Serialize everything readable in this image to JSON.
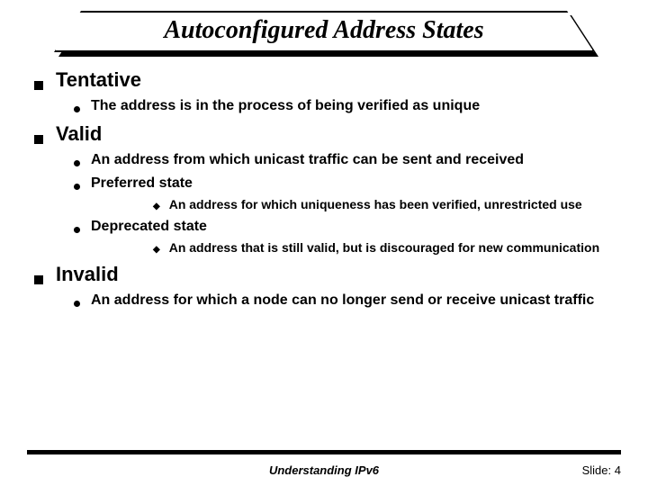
{
  "title": "Autoconfigured Address States",
  "sections": [
    {
      "heading": "Tentative",
      "items": [
        {
          "text": "The address is in the process of being verified as unique"
        }
      ]
    },
    {
      "heading": "Valid",
      "items": [
        {
          "text": "An address from which unicast traffic can be sent and received"
        },
        {
          "text": "Preferred state",
          "subitems": [
            "An address for which uniqueness has been verified, unrestricted use"
          ]
        },
        {
          "text": "Deprecated state",
          "subitems": [
            "An address that is still valid, but is discouraged for new communication"
          ]
        }
      ]
    },
    {
      "heading": "Invalid",
      "items": [
        {
          "text": "An address for which a node can no longer send or receive unicast traffic"
        }
      ]
    }
  ],
  "footer": {
    "center": "Understanding IPv6",
    "slide_label": "Slide:",
    "slide_number": "4"
  }
}
